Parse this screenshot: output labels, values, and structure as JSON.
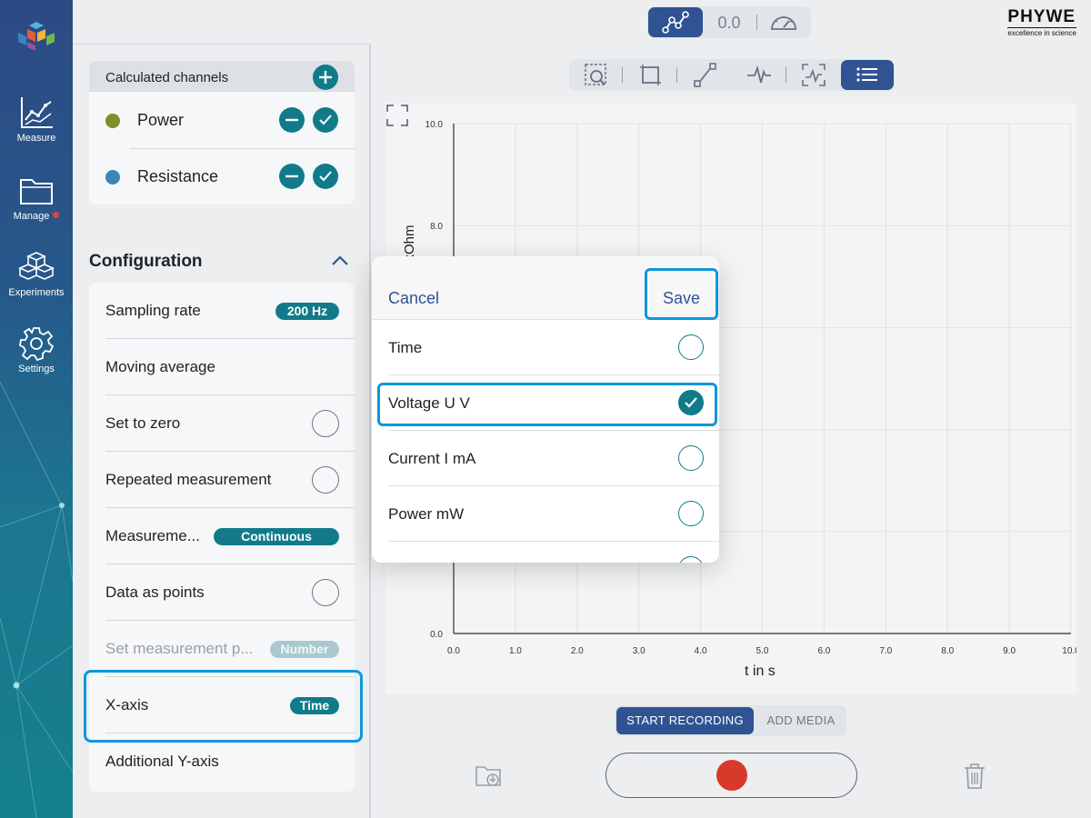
{
  "rail": {
    "items": [
      {
        "label": "Measure",
        "icon": "line-chart-icon"
      },
      {
        "label": "Manage",
        "icon": "folder-icon",
        "badge": true
      },
      {
        "label": "Experiments",
        "icon": "cubes-icon"
      },
      {
        "label": "Settings",
        "icon": "gear-icon"
      }
    ]
  },
  "topbar": {
    "display_value": "0.0",
    "brand": "PHYWE",
    "brand_tagline": "excellence in science"
  },
  "calculated_channels": {
    "title": "Calculated channels",
    "channels": [
      {
        "name": "Power",
        "color": "#7d8f2a"
      },
      {
        "name": "Resistance",
        "color": "#3a86b8"
      }
    ]
  },
  "configuration": {
    "title": "Configuration",
    "rows": [
      {
        "label": "Sampling rate",
        "value": "200 Hz"
      },
      {
        "label": "Moving average"
      },
      {
        "label": "Set to zero"
      },
      {
        "label": "Repeated measurement"
      },
      {
        "label": "Measureme...",
        "value": "Continuous"
      },
      {
        "label": "Data as points"
      },
      {
        "label": "Set measurement p...",
        "value": "Number",
        "disabled": true
      },
      {
        "label": "X-axis",
        "value": "Time"
      },
      {
        "label": "Additional Y-axis"
      }
    ]
  },
  "chart_data": {
    "type": "line",
    "xlabel": "t in s",
    "ylabel": "n kOhm",
    "xlim": [
      0,
      10
    ],
    "ylim": [
      0,
      10
    ],
    "x_ticks": [
      "0.0",
      "1.0",
      "2.0",
      "3.0",
      "4.0",
      "5.0",
      "6.0",
      "7.0",
      "8.0",
      "9.0",
      "10.0"
    ],
    "y_ticks": [
      "0.0",
      "8.0",
      "10.0"
    ],
    "grid": true,
    "series": []
  },
  "recording": {
    "start_label": "START RECORDING",
    "media_label": "ADD MEDIA"
  },
  "modal": {
    "cancel": "Cancel",
    "save": "Save",
    "options": [
      {
        "label": "Time",
        "checked": false
      },
      {
        "label": "Voltage U V",
        "checked": true
      },
      {
        "label": "Current I mA",
        "checked": false
      },
      {
        "label": "Power mW",
        "checked": false
      }
    ]
  },
  "colors": {
    "accent_teal": "#117b8a",
    "accent_blue": "#2f5393",
    "focus_ring": "#0e97dd",
    "record_red": "#d8392b"
  }
}
